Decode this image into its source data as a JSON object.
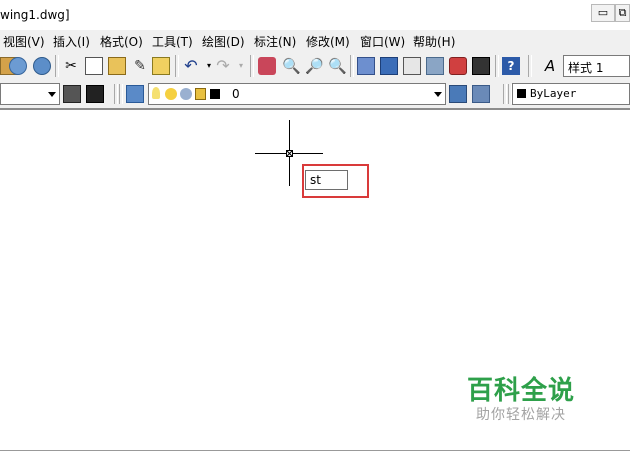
{
  "window": {
    "title": "wing1.dwg]",
    "minimize_label": "▭",
    "restore_label": "⧉"
  },
  "menu": {
    "items": [
      {
        "label": "视图(V)"
      },
      {
        "label": "插入(I)"
      },
      {
        "label": "格式(O)"
      },
      {
        "label": "工具(T)"
      },
      {
        "label": "绘图(D)"
      },
      {
        "label": "标注(N)"
      },
      {
        "label": "修改(M)"
      },
      {
        "label": "窗口(W)"
      },
      {
        "label": "帮助(H)"
      }
    ]
  },
  "toolbar1": {
    "text_style_value": "样式 1"
  },
  "toolbar2": {
    "layer_value": "0",
    "color_value": "ByLayer"
  },
  "canvas": {
    "command_input_value": "st"
  },
  "watermark": {
    "title": "百科全说",
    "subtitle": "助你轻松解决"
  },
  "colors": {
    "highlight": "#d93a3a",
    "watermark_green": "#2ea04a"
  }
}
